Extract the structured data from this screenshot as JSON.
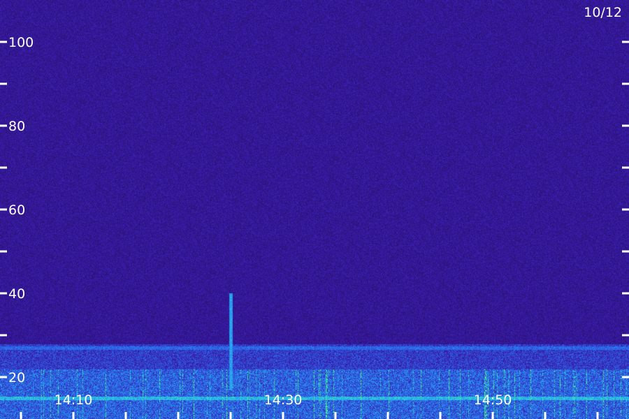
{
  "chart_data": {
    "type": "heatmap",
    "title": "",
    "date_label": "10/12",
    "xlabel": "",
    "ylabel": "",
    "y_range": [
      10,
      110
    ],
    "y_tick_labels": [
      {
        "value": 20,
        "label": "20"
      },
      {
        "value": 40,
        "label": "40"
      },
      {
        "value": 60,
        "label": "60"
      },
      {
        "value": 80,
        "label": "80"
      },
      {
        "value": 100,
        "label": "100"
      }
    ],
    "y_minor_ticks": [
      30,
      50,
      70,
      90
    ],
    "x_range_minutes": [
      "14:03",
      "15:03"
    ],
    "x_tick_labels": [
      {
        "time": "14:10",
        "label": "14:10"
      },
      {
        "time": "14:30",
        "label": "14:30"
      },
      {
        "time": "14:50",
        "label": "14:50"
      }
    ],
    "x_ticks_every_minutes": 5,
    "colormap": [
      "#1a0a45",
      "#3a1aa8",
      "#2a6ef0",
      "#27c8e8",
      "#4cff7a"
    ],
    "bands": [
      {
        "y_from": 10,
        "y_to": 22,
        "intensity": "high"
      },
      {
        "y_from": 22,
        "y_to": 28,
        "intensity": "medium"
      },
      {
        "y_from": 28,
        "y_to": 110,
        "intensity": "low"
      }
    ],
    "features": [
      {
        "type": "horizontal_line",
        "y": 27,
        "intensity": "high"
      },
      {
        "type": "horizontal_line",
        "y": 15,
        "intensity": "very_high"
      },
      {
        "type": "vertical_spike",
        "time": "14:25",
        "y_from": 17,
        "y_to": 40
      }
    ]
  }
}
